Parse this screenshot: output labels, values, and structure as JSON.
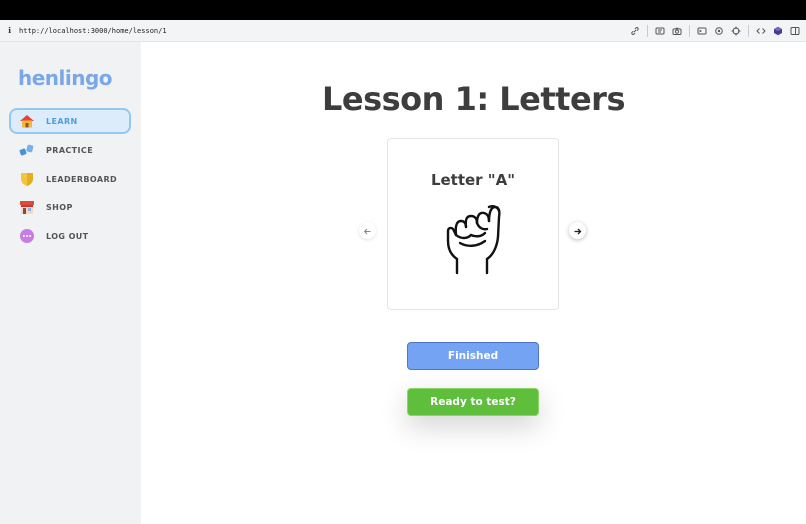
{
  "browser": {
    "url": "http://localhost:3000/home/lesson/1",
    "info_icon": "info-icon",
    "tools": [
      "link-icon",
      "reader-icon",
      "camera-icon",
      "terminal-icon",
      "settings-icon",
      "crosshair-icon",
      "code-icon",
      "extension-icon",
      "sidebar-icon"
    ]
  },
  "sidebar": {
    "logo": "henlingo",
    "items": [
      {
        "label": "LEARN",
        "icon": "house-icon",
        "active": true
      },
      {
        "label": "PRACTICE",
        "icon": "weights-icon",
        "active": false
      },
      {
        "label": "LEADERBOARD",
        "icon": "shield-icon",
        "active": false
      },
      {
        "label": "SHOP",
        "icon": "shop-icon",
        "active": false
      },
      {
        "label": "LOG OUT",
        "icon": "more-icon",
        "active": false
      }
    ]
  },
  "lesson": {
    "title": "Lesson 1: Letters",
    "card_title": "Letter \"A\"",
    "card_image": "sign-language-a-icon",
    "prev_icon": "arrow-left-icon",
    "next_icon": "arrow-right-icon"
  },
  "buttons": {
    "finished": "Finished",
    "ready": "Ready to test?"
  },
  "colors": {
    "logo": "#7aa7e8",
    "active_nav_bg": "#dcecfa",
    "active_nav_text": "#4c9fdc",
    "finished_button": "#74a3f3",
    "ready_button": "#5fbe3c"
  }
}
